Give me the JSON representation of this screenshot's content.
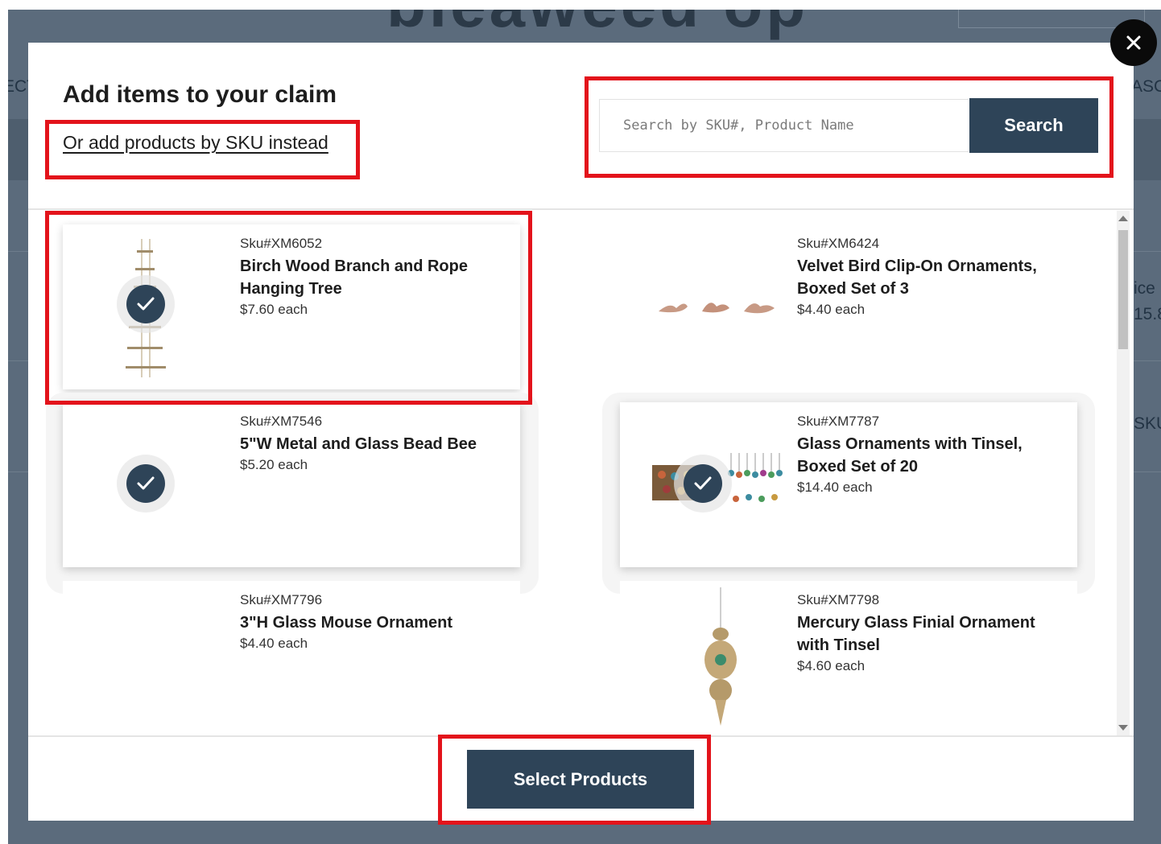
{
  "background": {
    "headline": "bleaweed op",
    "fragments": [
      "ECT",
      "ASC",
      "ice",
      "15.8",
      "SKU"
    ]
  },
  "modal": {
    "title": "Add items to your claim",
    "sku_link": "Or add products by SKU instead",
    "search": {
      "placeholder": "Search by SKU#, Product Name",
      "value": "",
      "button_label": "Search"
    },
    "products": [
      {
        "sku": "Sku#XM6052",
        "name": "Birch Wood Branch and Rope Hanging Tree",
        "price": "$7.60 each",
        "selected": true,
        "image": "birch-rope-tree-image"
      },
      {
        "sku": "Sku#XM6424",
        "name": "Velvet Bird Clip-On Ornaments, Boxed Set of 3",
        "price": "$4.40 each",
        "selected": false,
        "image": "velvet-birds-image"
      },
      {
        "sku": "Sku#XM7546",
        "name": "5\"W Metal and Glass Bead Bee",
        "price": "$5.20 each",
        "selected": true,
        "image": "none"
      },
      {
        "sku": "Sku#XM7787",
        "name": "Glass Ornaments with Tinsel, Boxed Set of 20",
        "price": "$14.40 each",
        "selected": true,
        "image": "glass-ornaments-box-image"
      },
      {
        "sku": "Sku#XM7796",
        "name": "3\"H Glass Mouse Ornament",
        "price": "$4.40 each",
        "selected": false,
        "image": "none"
      },
      {
        "sku": "Sku#XM7798",
        "name": "Mercury Glass Finial Ornament with Tinsel",
        "price": "$4.60 each",
        "selected": false,
        "image": "mercury-finial-image"
      }
    ],
    "select_button_label": "Select Products"
  },
  "icons": {
    "close": "close-icon",
    "check": "check-icon"
  },
  "colors": {
    "primary": "#2e4458",
    "highlight": "#e3131b",
    "backdrop": "#5b6b7c"
  }
}
